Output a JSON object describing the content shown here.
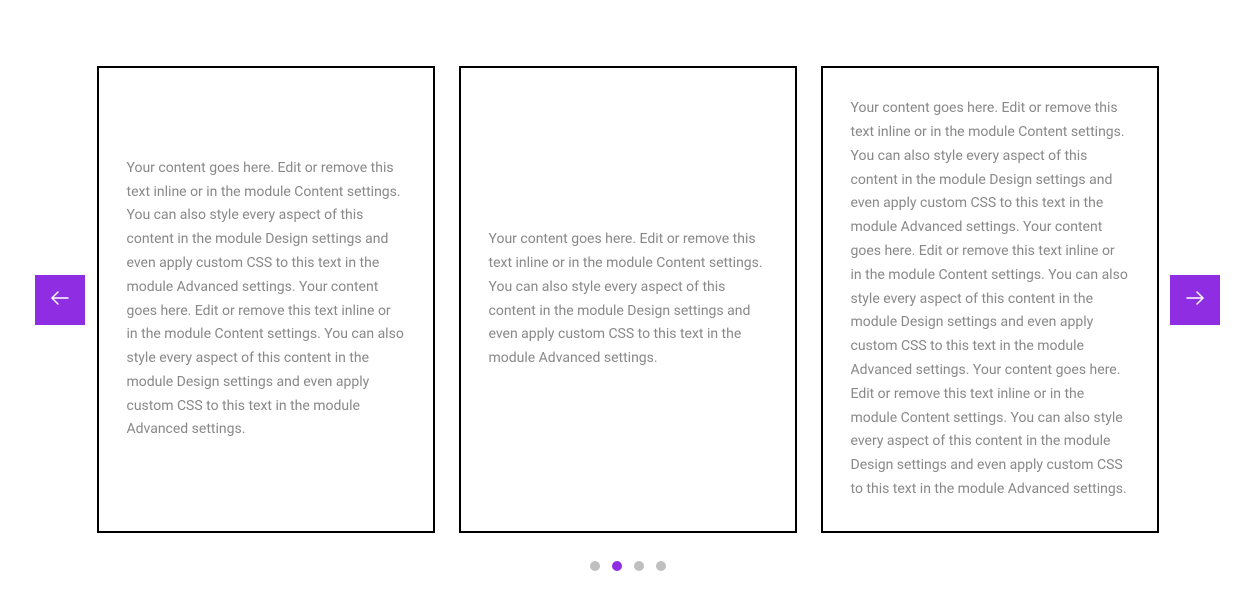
{
  "colors": {
    "accent": "#8e2de2",
    "dot_inactive": "#bfbfbf",
    "text": "#888888",
    "border": "#000000"
  },
  "carousel": {
    "cards": [
      {
        "text": "Your content goes here. Edit or remove this text inline or in the module Content settings. You can also style every aspect of this content in the module Design settings and even apply custom CSS to this text in the module Advanced settings. Your content goes here. Edit or remove this text inline or in the module Content settings. You can also style every aspect of this content in the module Design settings and even apply custom CSS to this text in the module Advanced settings."
      },
      {
        "text": "Your content goes here. Edit or remove this text inline or in the module Content settings. You can also style every aspect of this content in the module Design settings and even apply custom CSS to this text in the module Advanced settings."
      },
      {
        "text": "Your content goes here. Edit or remove this text inline or in the module Content settings. You can also style every aspect of this content in the module Design settings and even apply custom CSS to this text in the module Advanced settings. Your content goes here. Edit or remove this text inline or in the module Content settings. You can also style every aspect of this content in the module Design settings and even apply custom CSS to this text in the module Advanced settings. Your content goes here. Edit or remove this text inline or in the module Content settings. You can also style every aspect of this content in the module Design settings and even apply custom CSS to this text in the module Advanced settings."
      }
    ],
    "dots": {
      "count": 4,
      "active_index": 1
    }
  }
}
